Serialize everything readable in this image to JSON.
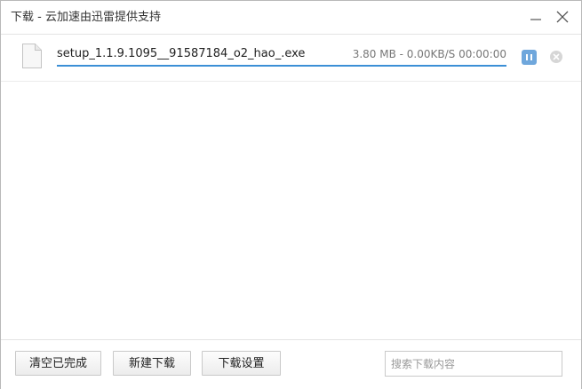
{
  "window": {
    "title": "下载 - 云加速由迅雷提供支持"
  },
  "task": {
    "file_name": "setup_1.1.9.1095__91587184_o2_hao_.exe",
    "status": "3.80 MB - 0.00KB/S 00:00:00",
    "progress": 1.0,
    "file_icon": "file-icon",
    "pause_icon": "pause-icon",
    "cancel_icon": "close-circle-icon"
  },
  "footer": {
    "clear_label": "清空已完成",
    "new_label": "新建下载",
    "settings_label": "下载设置",
    "search_placeholder": "搜索下载内容"
  },
  "colors": {
    "accent": "#3b8fd6",
    "pause_button": "#6fa7dc"
  }
}
